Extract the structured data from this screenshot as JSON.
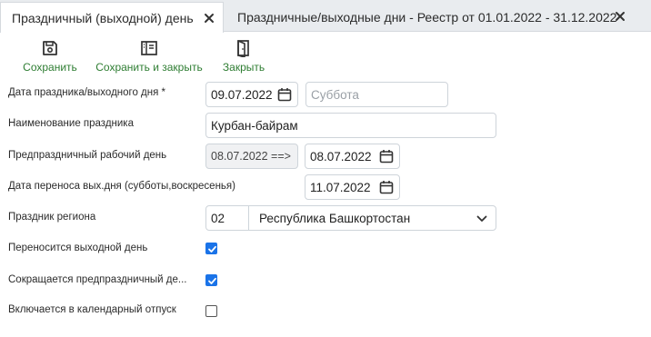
{
  "tabs": [
    {
      "label": "Праздничный (выходной) день",
      "active": true
    },
    {
      "label": "Праздничные/выходные дни - Реестр от 01.01.2022 - 31.12.2022",
      "active": false
    }
  ],
  "toolbar": {
    "save_label": "Сохранить",
    "save_close_label": "Сохранить и закрыть",
    "close_label": "Закрыть",
    "accent_color": "#2e7d32"
  },
  "form": {
    "holiday_date": {
      "label": "Дата праздника/выходного дня *",
      "value": "09.07.2022",
      "weekday_placeholder": "Суббота"
    },
    "holiday_name": {
      "label": "Наименование праздника",
      "value": "Курбан-байрам"
    },
    "pre_holiday": {
      "label": "Предпраздничный рабочий день",
      "from_value": "08.07.2022 ==>",
      "value": "08.07.2022"
    },
    "transfer_date": {
      "label": "Дата переноса вых.дня (субботы,воскресенья)",
      "value": "11.07.2022"
    },
    "region": {
      "label": "Праздник региона",
      "code": "02",
      "name": "Республика Башкортостан"
    },
    "transfer_day_off": {
      "label": "Переносится выходной день",
      "checked": true
    },
    "shortened_pre_holiday": {
      "label": "Сокращается предпраздничный де...",
      "checked": true
    },
    "included_vacation": {
      "label": "Включается в календарный отпуск",
      "checked": false
    }
  },
  "icons": {
    "close": "close-icon",
    "save": "floppy-disk-icon",
    "save_close": "save-and-close-icon",
    "exit": "door-exit-icon",
    "calendar": "calendar-icon",
    "dropdown": "chevron-down-icon",
    "checkmark": "checkmark-icon"
  },
  "colors": {
    "checkbox_checked": "#1a73e8",
    "tab_bar": "#e9ecef"
  }
}
